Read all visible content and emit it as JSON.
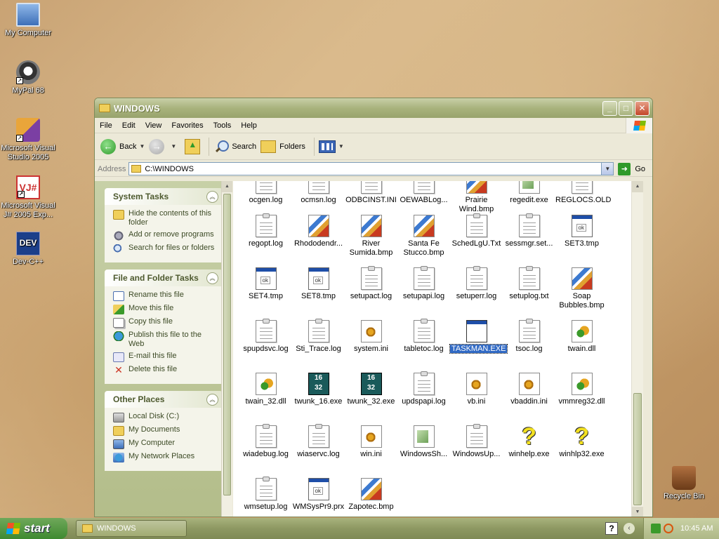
{
  "desktop": {
    "icons": [
      {
        "label": "My Computer",
        "icon": "computer-icon"
      },
      {
        "label": "MyPal 68",
        "icon": "mypal-icon"
      },
      {
        "label": "Microsoft Visual Studio 2005",
        "icon": "visual-studio-icon"
      },
      {
        "label": "Microsoft Visual J# 2005 Exp...",
        "icon": "visual-jsharp-icon"
      },
      {
        "label": "Dev-C++",
        "icon": "dev-cpp-icon"
      },
      {
        "label": "Recycle Bin",
        "icon": "recycle-bin-icon"
      }
    ]
  },
  "window": {
    "title": "WINDOWS",
    "menu": [
      "File",
      "Edit",
      "View",
      "Favorites",
      "Tools",
      "Help"
    ],
    "toolbar": {
      "back": "Back",
      "search": "Search",
      "folders": "Folders"
    },
    "address": {
      "label": "Address",
      "value": "C:\\WINDOWS",
      "go": "Go"
    }
  },
  "left_pane": {
    "system_tasks": {
      "title": "System Tasks",
      "items": [
        "Hide the contents of this folder",
        "Add or remove programs",
        "Search for files or folders"
      ]
    },
    "file_folder_tasks": {
      "title": "File and Folder Tasks",
      "items": [
        "Rename this file",
        "Move this file",
        "Copy this file",
        "Publish this file to the Web",
        "E-mail this file",
        "Delete this file"
      ]
    },
    "other_places": {
      "title": "Other Places",
      "items": [
        "Local Disk (C:)",
        "My Documents",
        "My Computer",
        "My Network Places"
      ]
    }
  },
  "files": [
    {
      "name": "ocgen.log",
      "type": "txt"
    },
    {
      "name": "ocmsn.log",
      "type": "txt"
    },
    {
      "name": "ODBCINST.INI",
      "type": "txt"
    },
    {
      "name": "OEWABLog...",
      "type": "txt"
    },
    {
      "name": "Prairie Wind.bmp",
      "type": "bmp"
    },
    {
      "name": "regedit.exe",
      "type": "exe"
    },
    {
      "name": "REGLOCS.OLD",
      "type": "txt"
    },
    {
      "name": "regopt.log",
      "type": "txt"
    },
    {
      "name": "Rhododendr...",
      "type": "bmp"
    },
    {
      "name": "River Sumida.bmp",
      "type": "bmp"
    },
    {
      "name": "Santa Fe Stucco.bmp",
      "type": "bmp"
    },
    {
      "name": "SchedLgU.Txt",
      "type": "txt"
    },
    {
      "name": "sessmgr.set...",
      "type": "txt"
    },
    {
      "name": "SET3.tmp",
      "type": "tmp"
    },
    {
      "name": "SET4.tmp",
      "type": "tmp"
    },
    {
      "name": "SET8.tmp",
      "type": "tmp"
    },
    {
      "name": "setupact.log",
      "type": "txt"
    },
    {
      "name": "setupapi.log",
      "type": "txt"
    },
    {
      "name": "setuperr.log",
      "type": "txt"
    },
    {
      "name": "setuplog.txt",
      "type": "txt"
    },
    {
      "name": "Soap Bubbles.bmp",
      "type": "bmp"
    },
    {
      "name": "spupdsvc.log",
      "type": "txt"
    },
    {
      "name": "Sti_Trace.log",
      "type": "txt"
    },
    {
      "name": "system.ini",
      "type": "sys"
    },
    {
      "name": "tabletoc.log",
      "type": "txt"
    },
    {
      "name": "TASKMAN.EXE",
      "type": "task",
      "selected": true
    },
    {
      "name": "tsoc.log",
      "type": "txt"
    },
    {
      "name": "twain.dll",
      "type": "dll"
    },
    {
      "name": "twain_32.dll",
      "type": "dll"
    },
    {
      "name": "twunk_16.exe",
      "type": "exe16"
    },
    {
      "name": "twunk_32.exe",
      "type": "exe16"
    },
    {
      "name": "updspapi.log",
      "type": "txt"
    },
    {
      "name": "vb.ini",
      "type": "sys"
    },
    {
      "name": "vbaddin.ini",
      "type": "sys"
    },
    {
      "name": "vmmreg32.dll",
      "type": "dll"
    },
    {
      "name": "wiadebug.log",
      "type": "txt"
    },
    {
      "name": "wiaservc.log",
      "type": "txt"
    },
    {
      "name": "win.ini",
      "type": "sys"
    },
    {
      "name": "WindowsSh...",
      "type": "gen"
    },
    {
      "name": "WindowsUp...",
      "type": "txt"
    },
    {
      "name": "winhelp.exe",
      "type": "help"
    },
    {
      "name": "winhlp32.exe",
      "type": "help"
    },
    {
      "name": "wmsetup.log",
      "type": "txt"
    },
    {
      "name": "WMSysPr9.prx",
      "type": "tmp"
    },
    {
      "name": "Zapotec.bmp",
      "type": "bmp"
    }
  ],
  "exe16_label": "16\n32",
  "taskbar": {
    "start": "start",
    "task_button": "WINDOWS",
    "clock": "10:45 AM",
    "help_glyph": "?"
  }
}
